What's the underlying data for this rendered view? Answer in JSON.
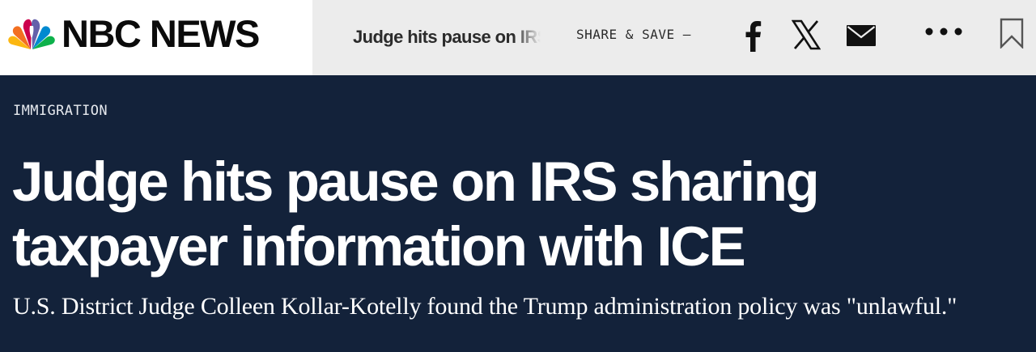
{
  "header": {
    "logo_text": "NBC NEWS",
    "headline_teaser": "Judge hits pause on IRS sharing taxpayer information with ICE",
    "share_label": "SHARE & SAVE —",
    "icons": [
      "peacock-logo",
      "facebook-icon",
      "x-icon",
      "mail-icon",
      "more-icon",
      "bookmark-icon"
    ]
  },
  "article": {
    "category": "IMMIGRATION",
    "headline": "Judge hits pause on IRS sharing taxpayer information with ICE",
    "dek": "U.S. District Judge Colleen Kollar-Kotelly found the Trump administration policy was \"unlawful.\""
  },
  "colors": {
    "header_bg": "#ececec",
    "logo_bg": "#ffffff",
    "article_bg": "#13223a",
    "text_on_dark": "#ffffff"
  }
}
